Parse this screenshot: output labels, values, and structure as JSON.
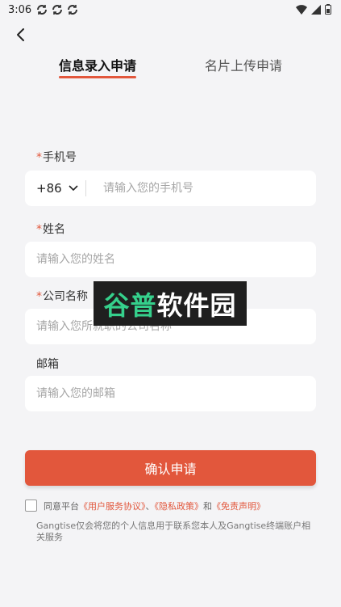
{
  "status_bar": {
    "time": "3:06"
  },
  "tabs": [
    {
      "label": "信息录入申请",
      "active": true
    },
    {
      "label": "名片上传申请",
      "active": false
    }
  ],
  "form": {
    "required_mark": "*",
    "phone": {
      "label": "手机号",
      "country_code": "+86",
      "placeholder": "请输入您的手机号"
    },
    "name": {
      "label": "姓名",
      "placeholder": "请输入您的姓名"
    },
    "company": {
      "label": "公司名称",
      "placeholder": "请输入您所就职的公司名称"
    },
    "email": {
      "label": "邮箱",
      "placeholder": "请输入您的邮箱"
    }
  },
  "watermark": {
    "part1": "谷普",
    "part2": "软件园"
  },
  "submit_label": "确认申请",
  "agreement": {
    "prefix": "同意平台",
    "user_agreement": "《用户服务协议》",
    "sep": "、",
    "privacy_policy": "《隐私政策》",
    "and": "和",
    "disclaimer": "《免责声明》",
    "note": "Gangtise仅会将您的个人信息用于联系您本人及Gangtise终端账户相关服务"
  },
  "colors": {
    "accent": "#e2573c",
    "background": "#f4f4f6"
  }
}
